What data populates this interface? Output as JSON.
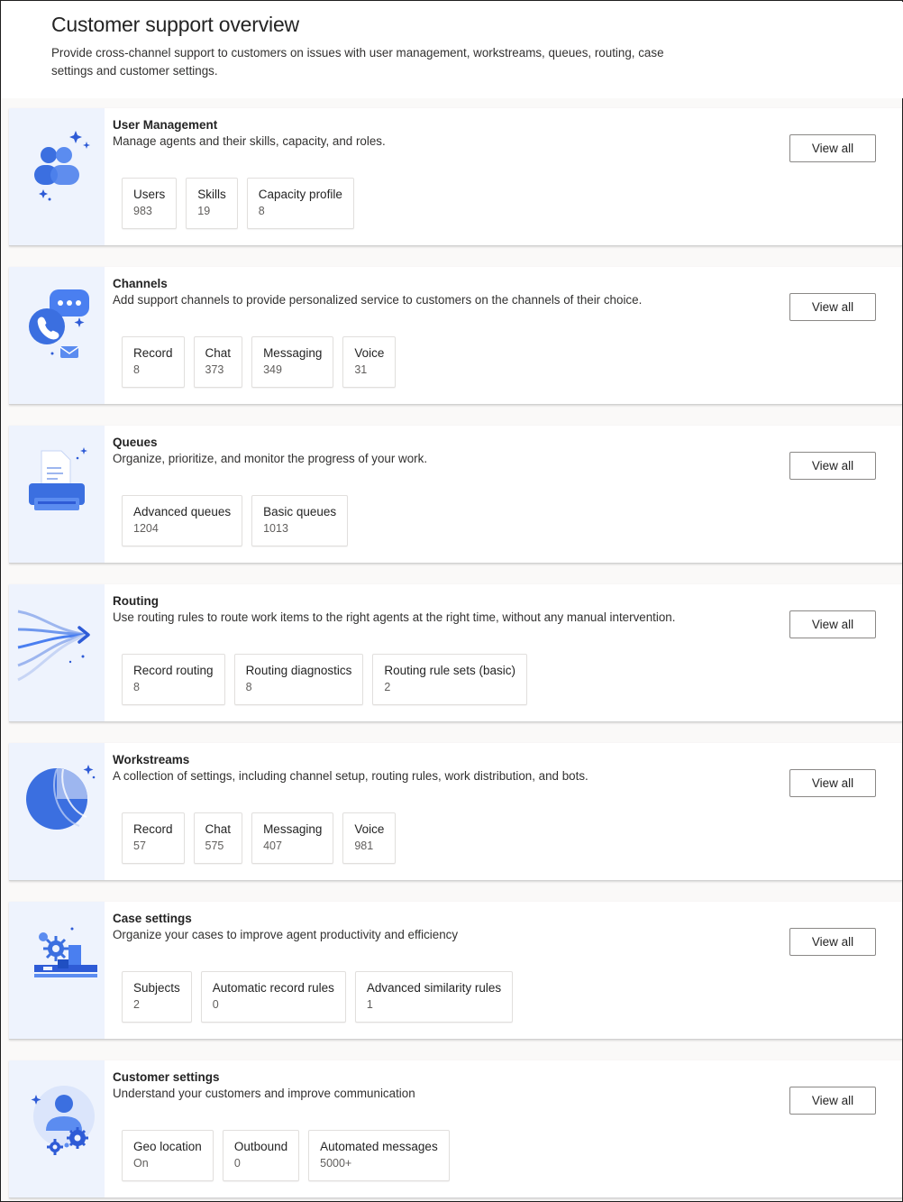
{
  "page": {
    "title": "Customer support overview",
    "description": "Provide cross-channel support to customers on issues with user management, workstreams, queues, routing, case settings and customer settings."
  },
  "view_all_label": "View all",
  "cards": [
    {
      "title": "User Management",
      "description": "Manage agents and their skills, capacity, and roles.",
      "icon": "users-icon",
      "tiles": [
        {
          "label": "Users",
          "value": "983"
        },
        {
          "label": "Skills",
          "value": "19"
        },
        {
          "label": "Capacity profile",
          "value": "8"
        }
      ]
    },
    {
      "title": "Channels",
      "description": "Add support channels to provide personalized service to customers on the channels of their choice.",
      "icon": "chat-phone-icon",
      "tiles": [
        {
          "label": "Record",
          "value": "8"
        },
        {
          "label": "Chat",
          "value": "373"
        },
        {
          "label": "Messaging",
          "value": "349"
        },
        {
          "label": "Voice",
          "value": "31"
        }
      ]
    },
    {
      "title": "Queues",
      "description": "Organize, prioritize, and monitor the progress of your work.",
      "icon": "printer-queue-icon",
      "tiles": [
        {
          "label": "Advanced queues",
          "value": "1204"
        },
        {
          "label": "Basic queues",
          "value": "1013"
        }
      ]
    },
    {
      "title": "Routing",
      "description": "Use routing rules to route work items to the right agents at the right time, without any manual intervention.",
      "icon": "routing-arrow-icon",
      "tiles": [
        {
          "label": "Record routing",
          "value": "8"
        },
        {
          "label": "Routing diagnostics",
          "value": "8"
        },
        {
          "label": "Routing rule sets (basic)",
          "value": "2"
        }
      ]
    },
    {
      "title": "Workstreams",
      "description": "A collection of settings, including channel setup, routing rules, work distribution, and bots.",
      "icon": "workstream-globe-icon",
      "tiles": [
        {
          "label": "Record",
          "value": "57"
        },
        {
          "label": "Chat",
          "value": "575"
        },
        {
          "label": "Messaging",
          "value": "407"
        },
        {
          "label": "Voice",
          "value": "981"
        }
      ]
    },
    {
      "title": "Case settings",
      "description": "Organize your cases to improve agent productivity and efficiency",
      "icon": "case-gear-icon",
      "tiles": [
        {
          "label": "Subjects",
          "value": "2"
        },
        {
          "label": "Automatic record rules",
          "value": "0"
        },
        {
          "label": "Advanced similarity rules",
          "value": "1"
        }
      ]
    },
    {
      "title": "Customer settings",
      "description": "Understand your customers and improve communication",
      "icon": "customer-gear-icon",
      "tiles": [
        {
          "label": "Geo location",
          "value": "On"
        },
        {
          "label": "Outbound",
          "value": "0"
        },
        {
          "label": "Automated messages",
          "value": "5000+"
        }
      ]
    }
  ]
}
